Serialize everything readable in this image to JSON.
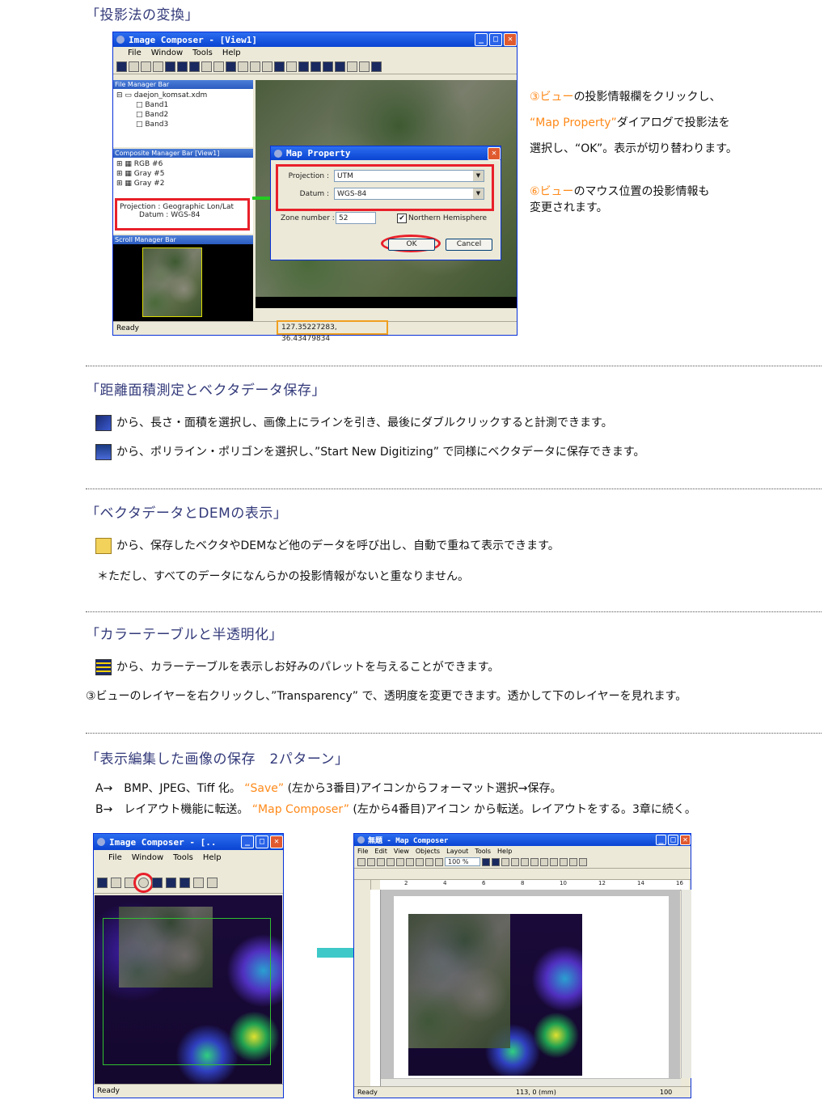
{
  "sections": {
    "projection": {
      "title": "「投影法の変換」",
      "note1_num": "③ビュー",
      "note1_rest": "の投影情報欄をクリックし、",
      "note2_quote": "“Map Property”",
      "note2_rest": "ダイアログで投影法を",
      "note3": "選択し、“OK”。表示が切り替わります。",
      "note4_num": "⑥ビュー",
      "note4_rest": "のマウス位置の投影情報も",
      "note5": "変更されます。"
    },
    "measure": {
      "title": "「距離面積測定とベクタデータ保存」",
      "line1": "から、長さ・面積を選択し、画像上にラインを引き、最後にダブルクリックすると計測できます。",
      "line2": "から、ポリライン・ポリゴンを選択し、”Start New Digitizing” で同様にベクタデータに保存できます。"
    },
    "vector": {
      "title": "「ベクタデータとDEMの表示」",
      "line1": "から、保存したベクタやDEMなど他のデータを呼び出し、自動で重ねて表示できます。",
      "line2": "＊ただし、すべてのデータになんらかの投影情報がないと重なりません。"
    },
    "color": {
      "title": "「カラーテーブルと半透明化」",
      "line1": "から、カラーテーブルを表示しお好みのパレットを与えることができます。",
      "line2": "③ビューのレイヤーを右クリックし、”Transparency” で、透明度を変更できます。透かして下のレイヤーを見れます。"
    },
    "save": {
      "title": "「表示編集した画像の保存　2パターン」",
      "lineA_pre": "A→　BMP、JPEG、Tiff 化。",
      "lineA_quote": "“Save”",
      "lineA_post": " (左から3番目)アイコンからフォーマット選択→保存。",
      "lineB_pre": "B→　レイアウト機能に転送。",
      "lineB_quote": "“Map Composer”",
      "lineB_post": " (左から4番目)アイコン から転送。レイアウトをする。3章に続く。"
    }
  },
  "window1": {
    "title": "Image Composer - [View1]",
    "menu": [
      "File",
      "Window",
      "Tools",
      "Help"
    ],
    "file_manager_title": "File Manager Bar",
    "file_tree": [
      "daejon_komsat.xdm",
      "Band1",
      "Band2",
      "Band3"
    ],
    "composite_title": "Composite Manager Bar [View1]",
    "composite_items": [
      "RGB #6",
      "Gray #5",
      "Gray #2"
    ],
    "projection_info_line1": "Projection : Geographic Lon/Lat",
    "projection_info_line2": "Datum : WGS-84",
    "scroll_title": "Scroll Manager Bar",
    "status": "Ready",
    "coords": "127.35227283, 36.43479834"
  },
  "dialog": {
    "title": "Map Property",
    "projection_label": "Projection :",
    "projection_value": "UTM",
    "datum_label": "Datum :",
    "datum_value": "WGS-84",
    "zone_label": "Zone number :",
    "zone_value": "52",
    "hemisphere_label": "Northern Hemisphere",
    "ok": "OK",
    "cancel": "Cancel"
  },
  "window2": {
    "title": "Image Composer - [..",
    "menu": [
      "File",
      "Window",
      "Tools",
      "Help"
    ],
    "status": "Ready"
  },
  "window3": {
    "title": "無題 - Map Composer",
    "menu": [
      "File",
      "Edit",
      "View",
      "Objects",
      "Layout",
      "Tools",
      "Help"
    ],
    "zoom": "100 %",
    "ruler_ticks": [
      "2",
      "4",
      "6",
      "8",
      "10",
      "12",
      "14",
      "16"
    ],
    "status": "Ready",
    "status_pos": "113, 0 (mm)",
    "status_zoom": "100"
  },
  "colors": {
    "heading": "#333a7a",
    "orange": "#ff8a1a",
    "red_highlight": "#e8202a",
    "green_link": "#22cc22",
    "cyan_arrow": "#3ec8c8"
  }
}
